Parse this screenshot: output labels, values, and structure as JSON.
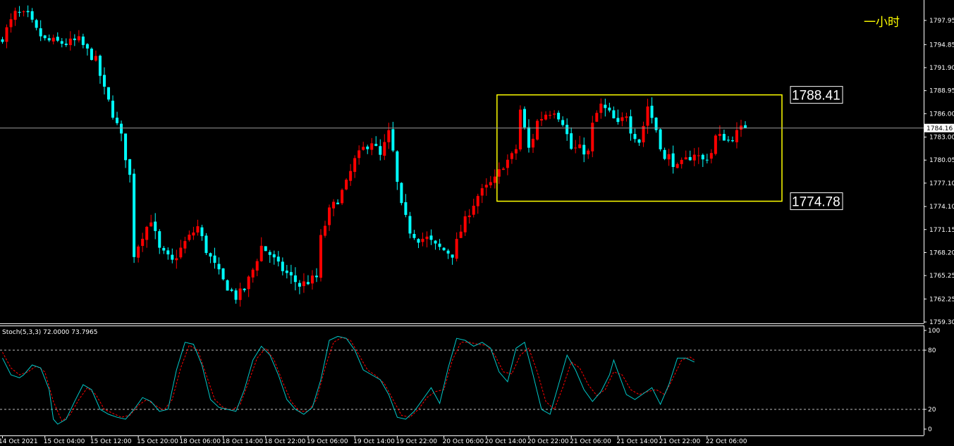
{
  "chart_data": {
    "type": "candlestick",
    "period_label": "一小时",
    "price_axis": {
      "ticks": [
        "1797.95",
        "1794.85",
        "1791.90",
        "1788.95",
        "1786.00",
        "1783.00",
        "1780.05",
        "1777.10",
        "1774.10",
        "1771.15",
        "1768.20",
        "1765.25",
        "1762.25",
        "1759.30"
      ],
      "ylim": [
        1759.3,
        1799.5
      ]
    },
    "current_price": {
      "label": "1784.16",
      "value": 1784.16
    },
    "range_box": {
      "top": {
        "label": "1788.41",
        "value": 1788.41
      },
      "bottom": {
        "label": "1774.78",
        "value": 1774.78
      },
      "start_index": 117,
      "end_index": 181
    },
    "time_axis": {
      "labels": [
        "14 Oct 2021",
        "15 Oct 04:00",
        "15 Oct 12:00",
        "15 Oct 20:00",
        "18 Oct 06:00",
        "18 Oct 14:00",
        "18 Oct 22:00",
        "19 Oct 06:00",
        "19 Oct 14:00",
        "19 Oct 22:00",
        "20 Oct 06:00",
        "20 Oct 14:00",
        "20 Oct 22:00",
        "21 Oct 06:00",
        "21 Oct 14:00",
        "21 Oct 22:00",
        "22 Oct 06:00"
      ],
      "label_indices": [
        0,
        10,
        21,
        32,
        42,
        52,
        62,
        72,
        83,
        93,
        104,
        114,
        124,
        134,
        145,
        155,
        166
      ]
    },
    "bull_color": "#ff0000",
    "bear_color": "#00ffff",
    "stochastic": {
      "label": "Stoch(5,3,3) 72.0000 73.7965",
      "ticks": [
        "100",
        "80",
        "20",
        "0"
      ],
      "levels": [
        80,
        20
      ],
      "main_color": "#00c8c8",
      "signal_color": "#ff0000"
    },
    "close_path": [
      [
        0,
        1795.8
      ],
      [
        3,
        1798.8
      ],
      [
        6,
        1798.5
      ],
      [
        8,
        1796.6
      ],
      [
        10,
        1795.4
      ],
      [
        15,
        1795.0
      ],
      [
        18,
        1795.4
      ],
      [
        20,
        1794.0
      ],
      [
        22,
        1792.8
      ],
      [
        24,
        1789.0
      ],
      [
        26,
        1786.0
      ],
      [
        28,
        1783.0
      ],
      [
        30,
        1778.0
      ],
      [
        31,
        1768.0
      ],
      [
        33,
        1770.5
      ],
      [
        35,
        1772.5
      ],
      [
        37,
        1768.5
      ],
      [
        40,
        1767.0
      ],
      [
        43,
        1769.5
      ],
      [
        46,
        1771.5
      ],
      [
        48,
        1768.5
      ],
      [
        50,
        1766.5
      ],
      [
        52,
        1764.5
      ],
      [
        55,
        1762.5
      ],
      [
        57,
        1763.5
      ],
      [
        59,
        1766.0
      ],
      [
        61,
        1769.0
      ],
      [
        63,
        1768.0
      ],
      [
        65,
        1766.5
      ],
      [
        67,
        1765.5
      ],
      [
        70,
        1764.0
      ],
      [
        72,
        1764.5
      ],
      [
        74,
        1765.0
      ],
      [
        75,
        1770.0
      ],
      [
        77,
        1773.5
      ],
      [
        79,
        1775.0
      ],
      [
        81,
        1777.0
      ],
      [
        83,
        1780.0
      ],
      [
        85,
        1781.5
      ],
      [
        87,
        1782.5
      ],
      [
        89,
        1780.5
      ],
      [
        91,
        1783.5
      ],
      [
        92,
        1781.0
      ],
      [
        93,
        1777.0
      ],
      [
        94,
        1774.0
      ],
      [
        96,
        1771.0
      ],
      [
        98,
        1770.0
      ],
      [
        100,
        1770.0
      ],
      [
        102,
        1769.0
      ],
      [
        104,
        1768.5
      ],
      [
        106,
        1768.0
      ],
      [
        108,
        1771.0
      ],
      [
        110,
        1773.5
      ],
      [
        112,
        1775.5
      ],
      [
        114,
        1776.5
      ],
      [
        116,
        1777.5
      ],
      [
        118,
        1779.5
      ],
      [
        120,
        1780.5
      ],
      [
        121,
        1781.5
      ],
      [
        122,
        1786.5
      ],
      [
        124,
        1781.5
      ],
      [
        125,
        1783.0
      ],
      [
        126,
        1785.0
      ],
      [
        128,
        1786.0
      ],
      [
        130,
        1786.5
      ],
      [
        132,
        1785.0
      ],
      [
        134,
        1781.5
      ],
      [
        136,
        1781.5
      ],
      [
        138,
        1781.0
      ],
      [
        139,
        1784.5
      ],
      [
        140,
        1786.0
      ],
      [
        141,
        1787.0
      ],
      [
        143,
        1786.0
      ],
      [
        145,
        1784.5
      ],
      [
        147,
        1786.0
      ],
      [
        148,
        1784.0
      ],
      [
        150,
        1782.5
      ],
      [
        151,
        1784.5
      ],
      [
        152,
        1787.0
      ],
      [
        154,
        1784.0
      ],
      [
        155,
        1782.0
      ],
      [
        156,
        1780.0
      ],
      [
        157,
        1780.5
      ],
      [
        159,
        1779.0
      ],
      [
        161,
        1780.0
      ],
      [
        163,
        1781.0
      ],
      [
        165,
        1780.0
      ],
      [
        167,
        1781.0
      ],
      [
        168,
        1783.0
      ],
      [
        170,
        1783.0
      ],
      [
        171,
        1782.5
      ],
      [
        173,
        1783.5
      ],
      [
        174,
        1784.0
      ],
      [
        175,
        1784.16
      ]
    ],
    "stoch_main": [
      [
        0,
        72
      ],
      [
        2,
        55
      ],
      [
        4,
        52
      ],
      [
        5,
        55
      ],
      [
        7,
        65
      ],
      [
        9,
        62
      ],
      [
        11,
        40
      ],
      [
        12,
        10
      ],
      [
        13,
        5
      ],
      [
        15,
        10
      ],
      [
        17,
        28
      ],
      [
        19,
        45
      ],
      [
        21,
        40
      ],
      [
        23,
        20
      ],
      [
        25,
        15
      ],
      [
        27,
        12
      ],
      [
        29,
        10
      ],
      [
        31,
        20
      ],
      [
        33,
        32
      ],
      [
        35,
        28
      ],
      [
        37,
        18
      ],
      [
        39,
        20
      ],
      [
        41,
        60
      ],
      [
        43,
        88
      ],
      [
        45,
        86
      ],
      [
        47,
        65
      ],
      [
        49,
        30
      ],
      [
        51,
        22
      ],
      [
        53,
        20
      ],
      [
        55,
        18
      ],
      [
        57,
        40
      ],
      [
        59,
        70
      ],
      [
        61,
        84
      ],
      [
        63,
        75
      ],
      [
        65,
        55
      ],
      [
        67,
        30
      ],
      [
        69,
        20
      ],
      [
        71,
        15
      ],
      [
        73,
        22
      ],
      [
        75,
        50
      ],
      [
        77,
        90
      ],
      [
        79,
        94
      ],
      [
        81,
        92
      ],
      [
        83,
        80
      ],
      [
        85,
        60
      ],
      [
        87,
        55
      ],
      [
        89,
        50
      ],
      [
        91,
        35
      ],
      [
        93,
        12
      ],
      [
        95,
        10
      ],
      [
        97,
        18
      ],
      [
        99,
        30
      ],
      [
        101,
        42
      ],
      [
        103,
        26
      ],
      [
        105,
        62
      ],
      [
        107,
        92
      ],
      [
        109,
        90
      ],
      [
        111,
        84
      ],
      [
        113,
        88
      ],
      [
        115,
        82
      ],
      [
        117,
        58
      ],
      [
        119,
        48
      ],
      [
        121,
        82
      ],
      [
        123,
        88
      ],
      [
        125,
        55
      ],
      [
        127,
        20
      ],
      [
        129,
        15
      ],
      [
        131,
        45
      ],
      [
        133,
        75
      ],
      [
        135,
        60
      ],
      [
        137,
        40
      ],
      [
        139,
        28
      ],
      [
        141,
        38
      ],
      [
        143,
        55
      ],
      [
        144,
        70
      ],
      [
        145,
        58
      ],
      [
        147,
        35
      ],
      [
        149,
        30
      ],
      [
        151,
        36
      ],
      [
        153,
        42
      ],
      [
        155,
        25
      ],
      [
        157,
        45
      ],
      [
        159,
        72
      ],
      [
        161,
        72
      ],
      [
        163,
        68
      ]
    ],
    "stoch_signal": [
      [
        0,
        78
      ],
      [
        2,
        62
      ],
      [
        4,
        55
      ],
      [
        6,
        58
      ],
      [
        8,
        64
      ],
      [
        10,
        58
      ],
      [
        12,
        28
      ],
      [
        14,
        8
      ],
      [
        16,
        15
      ],
      [
        18,
        30
      ],
      [
        20,
        42
      ],
      [
        22,
        35
      ],
      [
        24,
        20
      ],
      [
        26,
        16
      ],
      [
        28,
        12
      ],
      [
        30,
        14
      ],
      [
        32,
        24
      ],
      [
        34,
        30
      ],
      [
        36,
        24
      ],
      [
        38,
        19
      ],
      [
        40,
        30
      ],
      [
        42,
        62
      ],
      [
        44,
        85
      ],
      [
        46,
        80
      ],
      [
        48,
        55
      ],
      [
        50,
        30
      ],
      [
        52,
        22
      ],
      [
        54,
        19
      ],
      [
        56,
        25
      ],
      [
        58,
        48
      ],
      [
        60,
        72
      ],
      [
        62,
        82
      ],
      [
        64,
        70
      ],
      [
        66,
        48
      ],
      [
        68,
        28
      ],
      [
        70,
        18
      ],
      [
        72,
        18
      ],
      [
        74,
        30
      ],
      [
        76,
        62
      ],
      [
        78,
        88
      ],
      [
        80,
        93
      ],
      [
        82,
        90
      ],
      [
        84,
        75
      ],
      [
        86,
        60
      ],
      [
        88,
        54
      ],
      [
        90,
        46
      ],
      [
        92,
        30
      ],
      [
        94,
        14
      ],
      [
        96,
        12
      ],
      [
        98,
        20
      ],
      [
        100,
        32
      ],
      [
        102,
        38
      ],
      [
        104,
        40
      ],
      [
        106,
        70
      ],
      [
        108,
        88
      ],
      [
        110,
        88
      ],
      [
        112,
        86
      ],
      [
        114,
        85
      ],
      [
        116,
        75
      ],
      [
        118,
        58
      ],
      [
        120,
        56
      ],
      [
        122,
        75
      ],
      [
        124,
        82
      ],
      [
        126,
        58
      ],
      [
        128,
        28
      ],
      [
        130,
        20
      ],
      [
        132,
        42
      ],
      [
        134,
        68
      ],
      [
        136,
        62
      ],
      [
        138,
        45
      ],
      [
        140,
        34
      ],
      [
        142,
        40
      ],
      [
        144,
        58
      ],
      [
        146,
        55
      ],
      [
        148,
        40
      ],
      [
        150,
        35
      ],
      [
        152,
        38
      ],
      [
        154,
        40
      ],
      [
        156,
        35
      ],
      [
        158,
        52
      ],
      [
        160,
        70
      ],
      [
        162,
        73
      ],
      [
        163,
        70
      ]
    ],
    "grid": false
  }
}
